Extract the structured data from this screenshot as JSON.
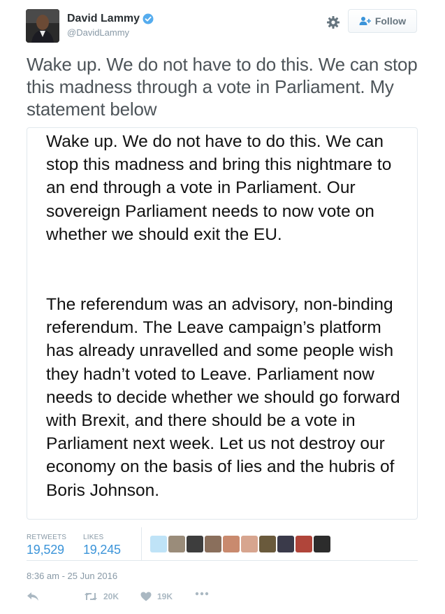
{
  "author": {
    "display_name": "David Lammy",
    "handle": "@DavidLammy",
    "verified": true
  },
  "header": {
    "settings_icon": "gear-icon",
    "follow_label": "Follow",
    "follow_icon": "person-add-icon"
  },
  "tweet": {
    "text": "Wake up. We do not have to do this. We can stop this madness through a vote in Parliament. My statement below"
  },
  "statement": {
    "paragraphs": [
      "Wake up. We do not have to do this. We can stop this madness and bring this nightmare to an end through a vote in Parliament. Our sovereign Parliament needs to now vote on whether we should exit the EU.",
      "The referendum was an advisory, non-binding referendum. The Leave campaign’s platform has already unravelled and some people wish they hadn’t voted to Leave. Parliament now needs to decide whether we should go forward with Brexit, and there should be a vote in Parliament next week. Let us not destroy our economy on the basis of lies and the hubris of Boris Johnson."
    ]
  },
  "stats": {
    "retweets_label": "RETWEETS",
    "retweets_value": "19,529",
    "likes_label": "LIKES",
    "likes_value": "19,245"
  },
  "likers": {
    "count": 10,
    "colors": [
      "#bfe3f7",
      "#9a8c7a",
      "#3d3d3d",
      "#8a6f5c",
      "#c98a6e",
      "#d7a58f",
      "#6a5a3c",
      "#3a3a4a",
      "#b0453a",
      "#2c2c2c"
    ]
  },
  "timestamp": "8:36 am - 25 Jun 2016",
  "actions": {
    "reply_icon": "reply-icon",
    "retweet_icon": "retweet-icon",
    "retweet_count": "20K",
    "like_icon": "heart-icon",
    "like_count": "19K",
    "more_icon": "more-dots-icon"
  },
  "colors": {
    "accent": "#3b94d9",
    "verified": "#55acee",
    "muted": "#8899a6",
    "border": "#e1e8ed"
  }
}
